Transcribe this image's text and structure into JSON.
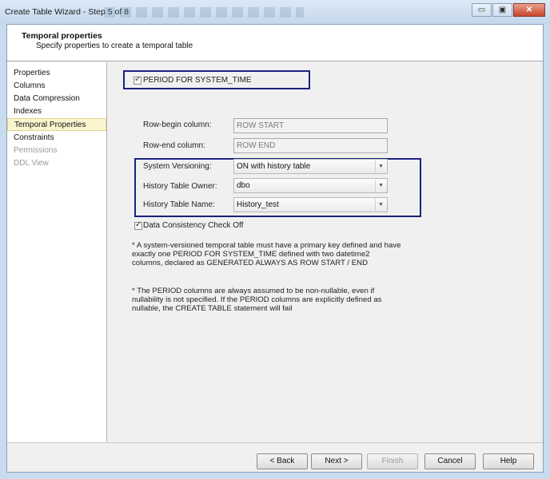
{
  "window": {
    "title": "Create Table Wizard - Step 5 of 8",
    "controls": {
      "minimize": "▭",
      "maximize": "▣",
      "close": "✕"
    }
  },
  "header": {
    "title": "Temporal properties",
    "subtitle": "Specify properties to create a temporal table"
  },
  "nav": {
    "items": [
      {
        "label": "Properties"
      },
      {
        "label": "Columns"
      },
      {
        "label": "Data Compression"
      },
      {
        "label": "Indexes"
      },
      {
        "label": "Temporal Properties"
      },
      {
        "label": "Constraints"
      },
      {
        "label": "Permissions"
      },
      {
        "label": "DDL View"
      }
    ]
  },
  "form": {
    "period_label": "PERIOD FOR SYSTEM_TIME",
    "row_begin_label": "Row-begin column:",
    "row_begin_value": "ROW START",
    "row_end_label": "Row-end column:",
    "row_end_value": "ROW END",
    "versioning_label": "System Versioning:",
    "versioning_value": "ON with history table",
    "owner_label": "History Table Owner:",
    "owner_value": "dbo",
    "name_label": "History Table Name:",
    "name_value": "History_test",
    "consistency_label": "Data Consistency Check Off"
  },
  "notes": {
    "note1_l1": "* A system-versioned temporal table must have a primary key defined and have",
    "note1_l2": "exactly one PERIOD FOR SYSTEM_TIME defined with two datetime2",
    "note1_l3": "columns, declared as GENERATED ALWAYS AS ROW START / END",
    "note2_l1": "* The PERIOD columns are always assumed to be non-nullable, even if",
    "note2_l2": "nullability is not specified. If the PERIOD columns are explicitly defined as",
    "note2_l3": "nullable, the CREATE TABLE statement will fail"
  },
  "footer": {
    "back": "< Back",
    "next": "Next >",
    "finish": "Finish",
    "cancel": "Cancel",
    "help": "Help"
  },
  "colors": {
    "highlight_box": "#1a237e",
    "active_nav": "#fbf5cf"
  }
}
